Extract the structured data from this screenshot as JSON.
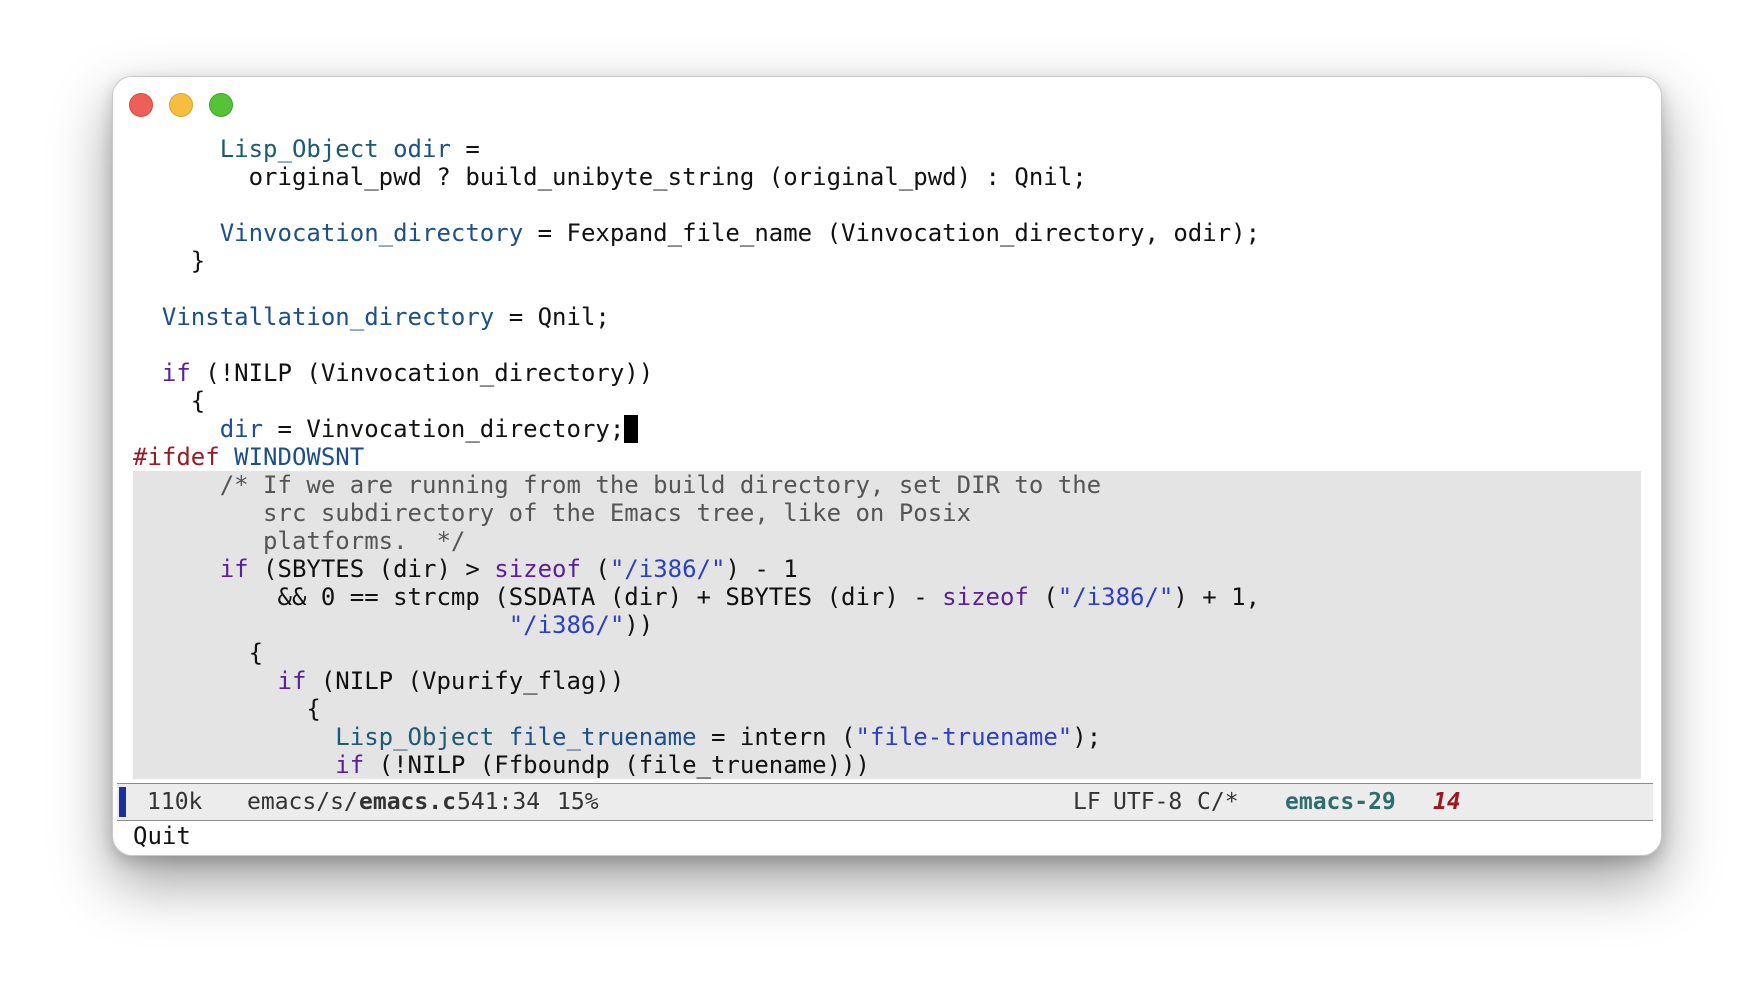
{
  "window": {
    "controls": [
      "close",
      "minimize",
      "maximize"
    ],
    "colors": {
      "close": "#ee5f57",
      "minimize": "#f6bd3f",
      "maximize": "#57c13a"
    }
  },
  "editor": {
    "cursor_after_line": 11,
    "shaded_from_line": 13,
    "lines": [
      {
        "indent": "      ",
        "tokens": [
          {
            "t": "Lisp_Object",
            "c": "type"
          },
          {
            "t": " "
          },
          {
            "t": "odir",
            "c": "var"
          },
          {
            "t": " ="
          }
        ]
      },
      {
        "indent": "        ",
        "tokens": [
          {
            "t": "original_pwd ? build_unibyte_string (original_pwd) : Qnil;"
          }
        ]
      },
      {
        "indent": "",
        "tokens": []
      },
      {
        "indent": "      ",
        "tokens": [
          {
            "t": "Vinvocation_directory",
            "c": "var"
          },
          {
            "t": " = Fexpand_file_name (Vinvocation_directory, odir);"
          }
        ]
      },
      {
        "indent": "    ",
        "tokens": [
          {
            "t": "}"
          }
        ]
      },
      {
        "indent": "",
        "tokens": []
      },
      {
        "indent": "  ",
        "tokens": [
          {
            "t": "Vinstallation_directory",
            "c": "var"
          },
          {
            "t": " = Qnil;"
          }
        ]
      },
      {
        "indent": "",
        "tokens": []
      },
      {
        "indent": "  ",
        "tokens": [
          {
            "t": "if",
            "c": "kw"
          },
          {
            "t": " (!NILP (Vinvocation_directory))"
          }
        ]
      },
      {
        "indent": "    ",
        "tokens": [
          {
            "t": "{"
          }
        ]
      },
      {
        "indent": "      ",
        "tokens": [
          {
            "t": "dir",
            "c": "var"
          },
          {
            "t": " = Vinvocation_directory;"
          }
        ]
      },
      {
        "indent": "",
        "tokens": [
          {
            "t": "#ifdef",
            "c": "pre"
          },
          {
            "t": " "
          },
          {
            "t": "WINDOWSNT",
            "c": "var"
          }
        ]
      },
      {
        "indent": "      ",
        "tokens": [
          {
            "t": "/* If we are running from the build directory, set DIR to the",
            "c": "comment"
          }
        ]
      },
      {
        "indent": "         ",
        "tokens": [
          {
            "t": "src subdirectory of the Emacs tree, like on Posix",
            "c": "comment"
          }
        ]
      },
      {
        "indent": "         ",
        "tokens": [
          {
            "t": "platforms.  */",
            "c": "comment"
          }
        ]
      },
      {
        "indent": "      ",
        "tokens": [
          {
            "t": "if",
            "c": "kw"
          },
          {
            "t": " (SBYTES (dir) > "
          },
          {
            "t": "sizeof",
            "c": "kw"
          },
          {
            "t": " ("
          },
          {
            "t": "\"/i386/\"",
            "c": "str"
          },
          {
            "t": ") - 1"
          }
        ]
      },
      {
        "indent": "          ",
        "tokens": [
          {
            "t": "&& 0 == strcmp (SSDATA (dir) + SBYTES (dir) - "
          },
          {
            "t": "sizeof",
            "c": "kw"
          },
          {
            "t": " ("
          },
          {
            "t": "\"/i386/\"",
            "c": "str"
          },
          {
            "t": ") + 1,"
          }
        ]
      },
      {
        "indent": "                          ",
        "tokens": [
          {
            "t": "\"/i386/\"",
            "c": "str"
          },
          {
            "t": "))"
          }
        ]
      },
      {
        "indent": "        ",
        "tokens": [
          {
            "t": "{"
          }
        ]
      },
      {
        "indent": "          ",
        "tokens": [
          {
            "t": "if",
            "c": "kw"
          },
          {
            "t": " (NILP (Vpurify_flag))"
          }
        ]
      },
      {
        "indent": "            ",
        "tokens": [
          {
            "t": "{"
          }
        ]
      },
      {
        "indent": "              ",
        "tokens": [
          {
            "t": "Lisp_Object",
            "c": "type"
          },
          {
            "t": " "
          },
          {
            "t": "file_truename",
            "c": "var"
          },
          {
            "t": " = intern ("
          },
          {
            "t": "\"file-truename\"",
            "c": "str"
          },
          {
            "t": ");"
          }
        ]
      },
      {
        "indent": "              ",
        "tokens": [
          {
            "t": "if",
            "c": "kw"
          },
          {
            "t": " (!NILP (Ffboundp (file_truename)))"
          }
        ]
      }
    ]
  },
  "modeline": {
    "size": "110k",
    "buffer_path": "emacs/s/",
    "buffer_name": "emacs.c",
    "position": "541:34",
    "percent": "15%",
    "eol": "LF",
    "encoding": "UTF-8",
    "mode": "C/*",
    "branch": "emacs-29",
    "error_count": "14",
    "accent_color": "#1c2fa0"
  },
  "echo_area": {
    "message": "Quit"
  }
}
